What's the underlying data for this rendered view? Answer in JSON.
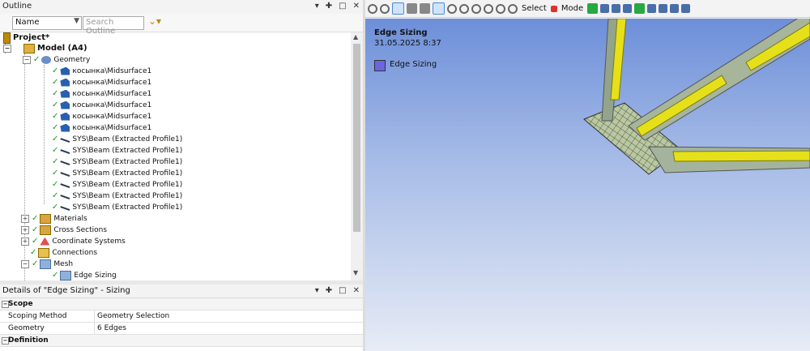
{
  "outline": {
    "title": "Outline",
    "filter_select": "Name",
    "search_placeholder": "Search Outline",
    "tree": [
      {
        "label": "Project*"
      },
      {
        "label": "Model (A4)"
      },
      {
        "label": "Geometry"
      },
      {
        "label": "косынка\\Midsurface1"
      },
      {
        "label": "косынка\\Midsurface1"
      },
      {
        "label": "косынка\\Midsurface1"
      },
      {
        "label": "косынка\\Midsurface1"
      },
      {
        "label": "косынка\\Midsurface1"
      },
      {
        "label": "косынка\\Midsurface1"
      },
      {
        "label": "SYS\\Beam (Extracted Profile1)"
      },
      {
        "label": "SYS\\Beam (Extracted Profile1)"
      },
      {
        "label": "SYS\\Beam (Extracted Profile1)"
      },
      {
        "label": "SYS\\Beam (Extracted Profile1)"
      },
      {
        "label": "SYS\\Beam (Extracted Profile1)"
      },
      {
        "label": "SYS\\Beam (Extracted Profile1)"
      },
      {
        "label": "SYS\\Beam (Extracted Profile1)"
      },
      {
        "label": "Materials"
      },
      {
        "label": "Cross Sections"
      },
      {
        "label": "Coordinate Systems"
      },
      {
        "label": "Connections"
      },
      {
        "label": "Mesh"
      },
      {
        "label": "Edge Sizing"
      }
    ]
  },
  "details": {
    "title": "Details of \"Edge Sizing\" - Sizing",
    "rows": [
      {
        "key": "Scope",
        "value": ""
      },
      {
        "key": "Scoping Method",
        "value": "Geometry Selection"
      },
      {
        "key": "Geometry",
        "value": "6 Edges"
      },
      {
        "key": "Definition",
        "value": ""
      }
    ]
  },
  "toolbar": {
    "select_label": "Select",
    "mode_label": "Mode"
  },
  "viewport": {
    "title": "Edge Sizing",
    "date": "31.05.2025 8:37",
    "legend_label": "Edge Sizing",
    "legend_color": "#6d64e0"
  },
  "colors": {
    "beam_yellow": "#e6e01a",
    "beam_gray": "#a7b59b",
    "background_top": "#6d8fd9",
    "background_bottom": "#e7ecf6"
  }
}
